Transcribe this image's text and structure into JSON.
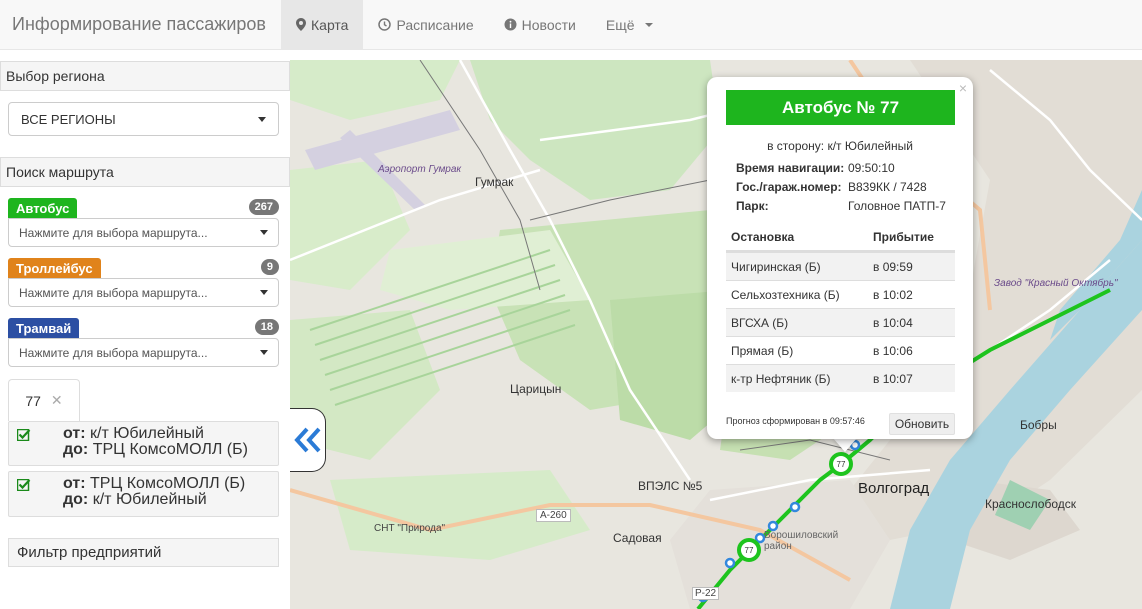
{
  "app": {
    "title": "Информирование пассажиров",
    "nav": [
      {
        "label": "Карта",
        "icon": "map-marker-icon",
        "active": true
      },
      {
        "label": "Расписание",
        "icon": "clock-icon",
        "active": false
      },
      {
        "label": "Новости",
        "icon": "info-icon",
        "active": false
      },
      {
        "label": "Ещё",
        "icon": "chevron-down-icon",
        "active": false
      }
    ]
  },
  "sidebar": {
    "region_heading": "Выбор региона",
    "region_value": "ВСЕ РЕГИОНЫ",
    "route_heading": "Поиск маршрута",
    "types": [
      {
        "label": "Автобус",
        "count": "267",
        "color": "#1eb51e",
        "placeholder": "Нажмите для выбора маршрута..."
      },
      {
        "label": "Троллейбус",
        "count": "9",
        "color": "#e0831b",
        "placeholder": "Нажмите для выбора маршрута..."
      },
      {
        "label": "Трамвай",
        "count": "18",
        "color": "#2c4fa3",
        "placeholder": "Нажмите для выбора маршрута..."
      }
    ],
    "selected_route_tag": "77",
    "directions": [
      {
        "from_label": "от:",
        "from": "к/т Юбилейный",
        "to_label": "до:",
        "to": "ТРЦ КомсоМОЛЛ (Б)"
      },
      {
        "from_label": "от:",
        "from": "ТРЦ КомсоМОЛЛ (Б)",
        "to_label": "до:",
        "to": "к/т Юбилейный"
      }
    ],
    "filter_heading": "Фильтр предприятий"
  },
  "map": {
    "labels": {
      "airport": "Аэропорт Гумрак",
      "gumrak": "Гумрак",
      "tsaritsyn": "Царицын",
      "vpls": "ВПЭЛС №5",
      "a260": "А-260",
      "snt": "СНТ \"Природа\"",
      "sadovaya": "Садовая",
      "volgograd": "Волгоград",
      "krasnoslobodsk": "Краснослободск",
      "bobry": "Бобры",
      "zavod": "Завод \"Красный Октябрь\"",
      "district": "Ворошиловский район",
      "r22": "Р-22"
    },
    "route_marker": "77",
    "route_color": "#1ec41e"
  },
  "popup": {
    "title": "Автобус № 77",
    "direction": "в сторону: к/т Юбилейный",
    "info": [
      {
        "key": "Время навигации:",
        "value": "09:50:10"
      },
      {
        "key": "Гос./гараж.номер:",
        "value": "В839КК / 7428"
      },
      {
        "key": "Парк:",
        "value": "Головное ПАТП-7"
      }
    ],
    "table_headers": {
      "stop": "Остановка",
      "arrival": "Прибытие"
    },
    "stops": [
      {
        "stop": "Чигиринская (Б)",
        "arrival": "в 09:59"
      },
      {
        "stop": "Сельхозтехника (Б)",
        "arrival": "в 10:02"
      },
      {
        "stop": "ВГСХА (Б)",
        "arrival": "в 10:04"
      },
      {
        "stop": "Прямая (Б)",
        "arrival": "в 10:06"
      },
      {
        "stop": "к-тр Нефтяник (Б)",
        "arrival": "в 10:07"
      }
    ],
    "forecast": "Прогноз сформирован в 09:57:46",
    "refresh_label": "Обновить",
    "close": "×"
  }
}
